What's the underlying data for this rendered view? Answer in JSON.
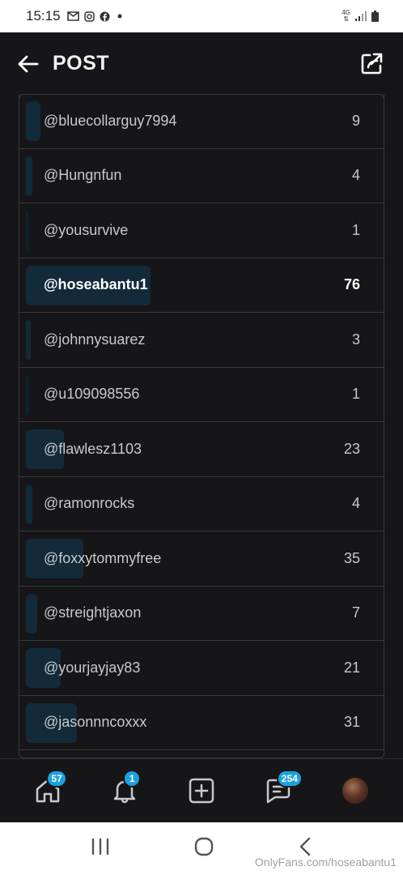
{
  "status_bar": {
    "time": "15:15",
    "network": "4G"
  },
  "header": {
    "title": "POST"
  },
  "voters": [
    {
      "user": "@bluecollarguy7994",
      "count": "9",
      "fraction": 0.118
    },
    {
      "user": "@Hungnfun",
      "count": "4",
      "fraction": 0.053
    },
    {
      "user": "@yousurvive",
      "count": "1",
      "fraction": 0.013
    },
    {
      "user": "@hoseabantu1",
      "count": "76",
      "fraction": 1.0,
      "highlight": true
    },
    {
      "user": "@johnnysuarez",
      "count": "3",
      "fraction": 0.039
    },
    {
      "user": "@u109098556",
      "count": "1",
      "fraction": 0.013
    },
    {
      "user": "@flawlesz1103",
      "count": "23",
      "fraction": 0.303
    },
    {
      "user": "@ramonrocks",
      "count": "4",
      "fraction": 0.053
    },
    {
      "user": "@foxxytommyfree",
      "count": "35",
      "fraction": 0.46
    },
    {
      "user": "@streightjaxon",
      "count": "7",
      "fraction": 0.092
    },
    {
      "user": "@yourjayjay83",
      "count": "21",
      "fraction": 0.276
    },
    {
      "user": "@jasonnncoxxx",
      "count": "31",
      "fraction": 0.408
    }
  ],
  "bottom_nav": {
    "home_badge": "57",
    "notifications_badge": "1",
    "messages_badge": "254"
  },
  "watermark": "OnlyFans.com/hoseabantu1",
  "colors": {
    "accent": "#1aa2e0",
    "bar": "#122a3a",
    "background": "#161618"
  }
}
